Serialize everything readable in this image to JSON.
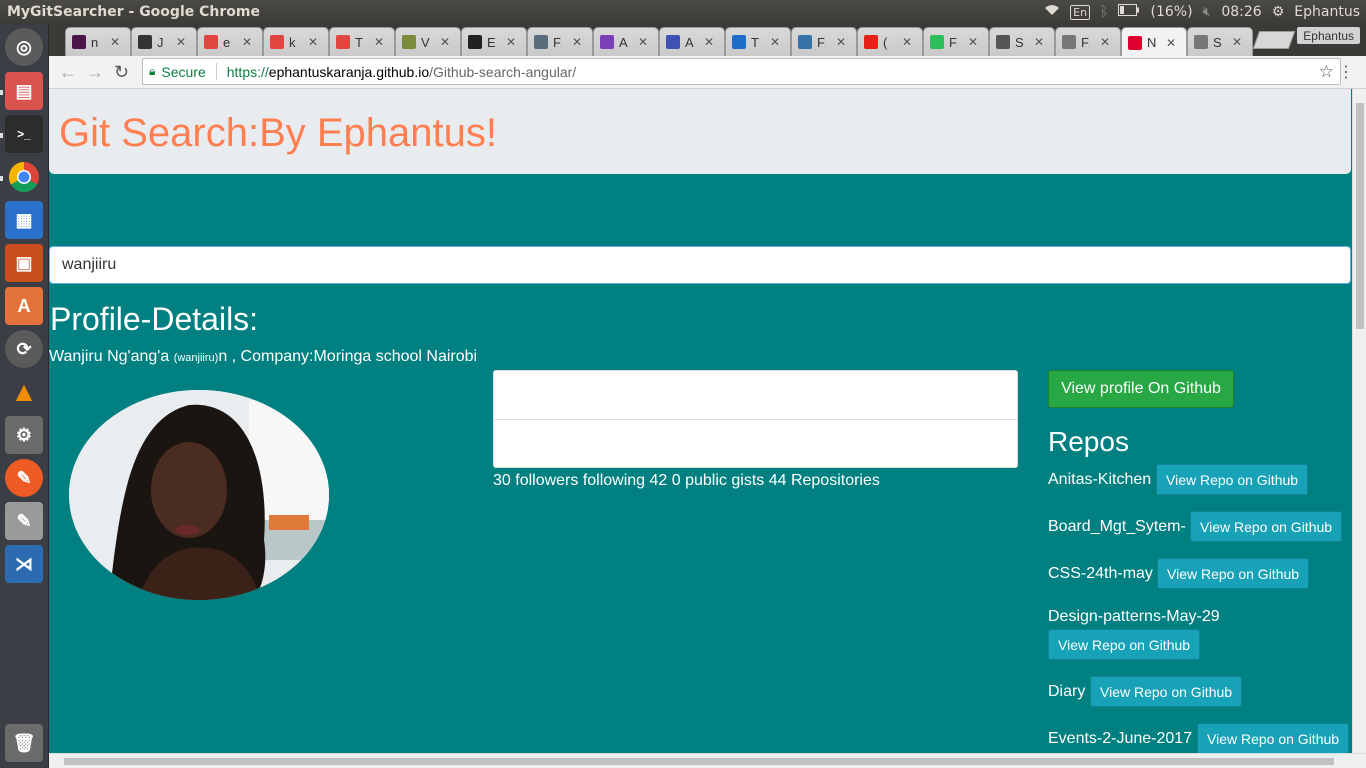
{
  "os": {
    "window_title": "MyGitSearcher - Google Chrome",
    "keyboard": "En",
    "battery": "(16%)",
    "clock": "08:26",
    "user": "Ephantus"
  },
  "browser": {
    "tabs": [
      {
        "icon": "slack-icon",
        "initial": "n",
        "color": "#4a154b"
      },
      {
        "icon": "terminal-icon",
        "initial": "J",
        "color": "#333333"
      },
      {
        "icon": "codepen-icon",
        "initial": "e",
        "color": "#e0463f"
      },
      {
        "icon": "codepen-icon",
        "initial": "k",
        "color": "#e0463f"
      },
      {
        "icon": "codepen-icon",
        "initial": "T",
        "color": "#e0463f"
      },
      {
        "icon": "tree-icon",
        "initial": "V",
        "color": "#7a8b3a"
      },
      {
        "icon": "github-icon",
        "initial": "E",
        "color": "#222222"
      },
      {
        "icon": "circle-icon",
        "initial": "F",
        "color": "#5a6b7c"
      },
      {
        "icon": "list-icon",
        "initial": "A",
        "color": "#7b3fb8"
      },
      {
        "icon": "angular-settings-icon",
        "initial": "A",
        "color": "#3f51b5"
      },
      {
        "icon": "e-icon",
        "initial": "T",
        "color": "#1e6ec8"
      },
      {
        "icon": "python-icon",
        "initial": "F",
        "color": "#3671a8"
      },
      {
        "icon": "youtube-icon",
        "initial": "(",
        "color": "#e62117"
      },
      {
        "icon": "h-icon",
        "initial": "F",
        "color": "#2dbd5a"
      },
      {
        "icon": "gear-icon",
        "initial": "S",
        "color": "#555555"
      },
      {
        "icon": "doc-icon",
        "initial": "F",
        "color": "#777777"
      },
      {
        "icon": "angular-icon",
        "initial": "N",
        "color": "#dd0031"
      },
      {
        "icon": "doc-icon",
        "initial": "S",
        "color": "#777777"
      }
    ],
    "active_tab_index": 16,
    "profile_name": "Ephantus",
    "secure_label": "Secure",
    "url_scheme": "https://",
    "url_host": "ephantuskaranja.github.io",
    "url_path": "/Github-search-angular/"
  },
  "page": {
    "title": "Git Search:By Ephantus!",
    "search_value": "wanjiiru",
    "profile_heading": "Profile-Details:",
    "profile_name": "Wanjiru Ng'ang'a ",
    "profile_login": "(wanjiiru)",
    "profile_suffix": "n , Company:Moringa school Nairobi",
    "stats_line": "30 followers following 42 0 public gists 44 Repositories",
    "view_profile_label": "View profile On Github",
    "repos_heading": "Repos",
    "repo_button_label": "View Repo on Github",
    "repos": [
      "Anitas-Kitchen",
      "Board_Mgt_Sytem-",
      "CSS-24th-may",
      "Design-patterns-May-29",
      "Diary",
      "Events-2-June-2017"
    ]
  }
}
